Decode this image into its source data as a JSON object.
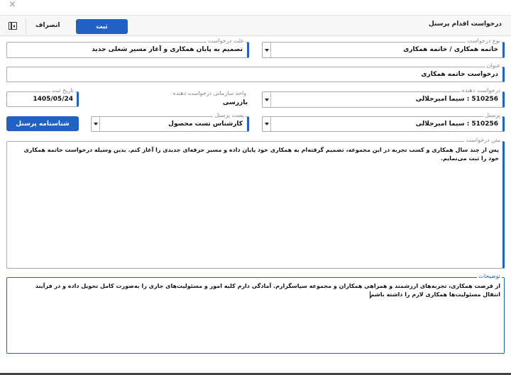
{
  "window": {
    "close_glyph": "×"
  },
  "header": {
    "title": "درخواست اقدام پرسنل",
    "submit_label": "ثبت",
    "cancel_label": "انصراف"
  },
  "form": {
    "request_type": {
      "label": "نوع درخواست",
      "value": "خاتمه همکاری / خاتمه همکاری"
    },
    "request_reason": {
      "label": "علت درخواست",
      "value": "تصمیم به پایان همکاری و آغاز مسیر شغلی جدید"
    },
    "subject": {
      "label": "عنوان",
      "value": "درخواست خاتمه همکاری"
    },
    "requester": {
      "label": "درخواست دهنده",
      "value": "510256 : سیما امیرجلالی"
    },
    "requester_unit": {
      "label": "واحد سازمانی درخواست دهنده",
      "value": "بازرسی"
    },
    "register_date": {
      "label": "تاریخ ثبت",
      "value": "1405/05/24"
    },
    "personnel": {
      "label": "پرسنل",
      "value": "510256 : سیما امیرجلالی"
    },
    "personnel_post": {
      "label": "پست پرسنل",
      "value": "کارشناس تست محصول"
    },
    "profile_button_label": "شناسنامه پرسنل",
    "request_text": {
      "label": "متن درخواست",
      "value": "پس از چند سال همکاری و کسب تجربه در این مجموعه، تصمیم گرفته‌ام به همکاری خود پایان داده و مسیر حرفه‌ای جدیدی را آغاز کنم. بدین وسیله درخواست خاتمه همکاری خود را ثبت می‌نمایم."
    },
    "description": {
      "label": "توضیحات",
      "value": "از فرصت همکاری، تجربه‌های ارزشمند و همراهی همکاران و مجموعه سپاسگزارم. آمادگی دارم کلیه امور و مسئولیت‌های جاری را به‌صورت کامل تحویل داده و در فرآیند انتقال مسئولیت‌ها همکاری لازم را داشته باشم"
    }
  },
  "colors": {
    "accent": "#1f62c3",
    "border": "#a9a9a9"
  }
}
